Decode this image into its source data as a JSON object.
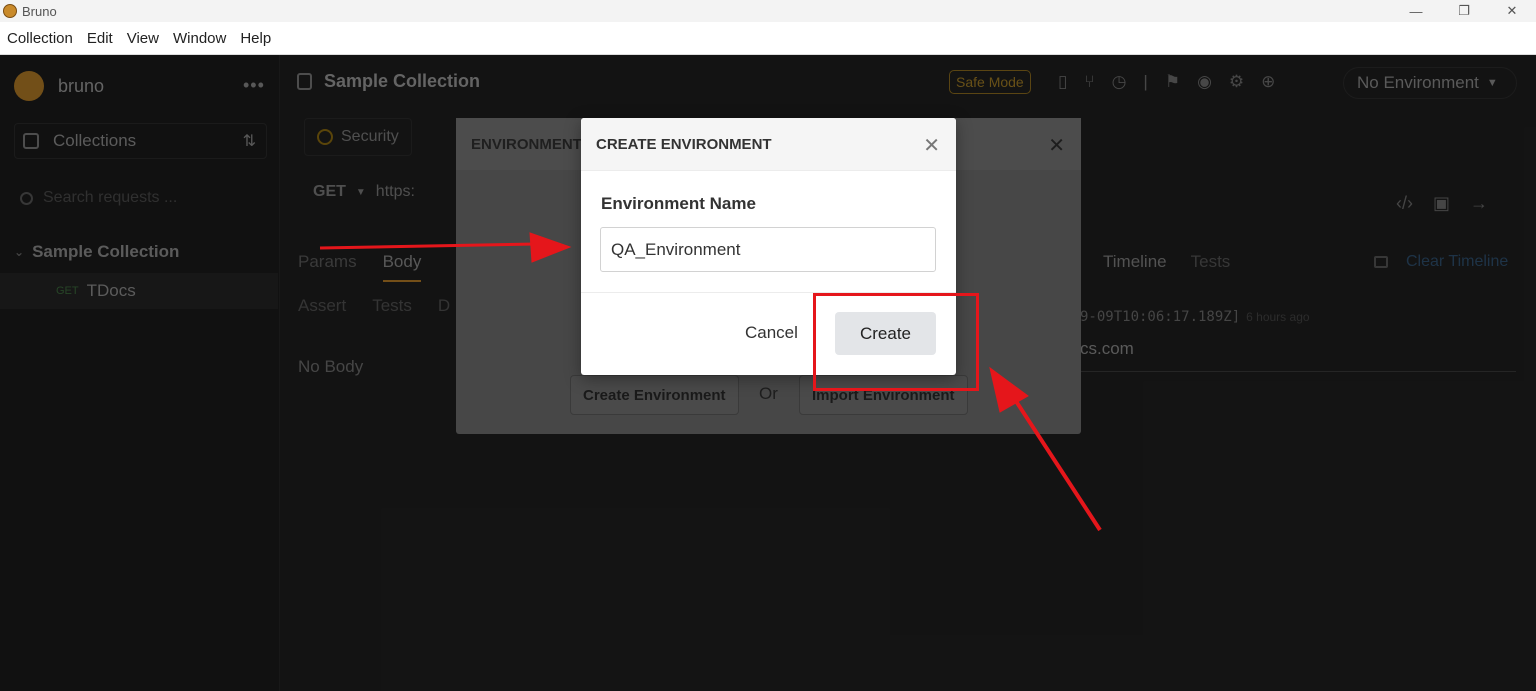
{
  "window": {
    "title": "Bruno",
    "controls": [
      "—",
      "❐",
      "✕"
    ]
  },
  "menu": [
    "Collection",
    "Edit",
    "View",
    "Window",
    "Help"
  ],
  "sidebar": {
    "brand": "bruno",
    "more": "•••",
    "collections_label": "Collections",
    "sort_icon": "⇅",
    "search_placeholder": "Search requests ...",
    "collection_name": "Sample Collection",
    "request_method": "GET",
    "request_name": "TDocs"
  },
  "topbar": {
    "collection_title": "Sample Collection",
    "safe_mode": "Safe Mode",
    "environment": "No Environment"
  },
  "request": {
    "tab_label": "Security",
    "method": "GET",
    "url_partial": "https:",
    "tabs": [
      "Params",
      "Body"
    ],
    "active_tab": "Body",
    "tabs2": [
      "Assert",
      "Tests",
      "D"
    ],
    "body_text": "No Body"
  },
  "response": {
    "tabs": [
      "Timeline",
      "Tests"
    ],
    "clear_label": "Clear Timeline",
    "timestamp": "9-09T10:06:17.189Z]",
    "ago": "6 hours ago",
    "url_partial": "cs.com"
  },
  "env_modal": {
    "title": "ENVIRONMENT",
    "create_btn": "Create Environment",
    "or": "Or",
    "import_btn": "Import Environment"
  },
  "create_modal": {
    "title": "CREATE ENVIRONMENT",
    "close": "✕",
    "field_label": "Environment Name",
    "field_value": "QA_Environment",
    "cancel": "Cancel",
    "create": "Create"
  },
  "annotation_color": "#e5161b"
}
